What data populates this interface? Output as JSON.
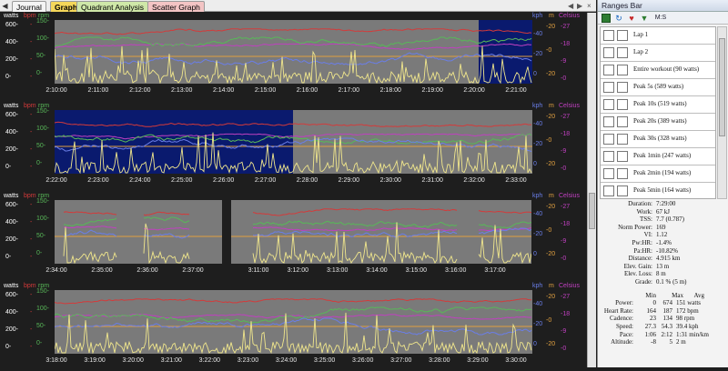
{
  "tabs": {
    "journal": "Journal",
    "graph": "Graph",
    "quadrant": "Quadrant Analysis",
    "scatter": "Scatter Graph"
  },
  "left_axis": {
    "watts_label": "watts",
    "bpm_label": "bpm",
    "rpm_label": "rpm",
    "watts_ticks": [
      "600-",
      "400-",
      "200-",
      "0-"
    ],
    "bpm_ticks": [
      "-",
      "-",
      "-",
      "-"
    ],
    "rpm_ticks": [
      "150-",
      "100-",
      "50-",
      "0-"
    ]
  },
  "right_axis": {
    "kph_label": "kph",
    "m_label": "m",
    "celsius_label": "Celsius",
    "c_ticks": [
      "-27",
      "-18",
      "-9",
      "-0"
    ],
    "m_ticks": [
      "-20",
      "-0",
      "-20"
    ],
    "kph_ticks": [
      "-40",
      "-20",
      "0"
    ]
  },
  "colors": {
    "watts": "#f0e68c",
    "bpm": "#d43a3a",
    "rpm": "#58b858",
    "kph": "#6a7ee8",
    "m": "#e0a040",
    "celsius": "#c040c0",
    "plot_bg": "#7a7a7a",
    "selection": "#0a1a6e"
  },
  "panels": [
    {
      "ticks": [
        "2:10:00",
        "2:11:00",
        "2:12:00",
        "2:13:00",
        "2:14:00",
        "2:15:00",
        "2:16:00",
        "2:17:00",
        "2:18:00",
        "2:19:00",
        "2:20:00",
        "2:21:00"
      ]
    },
    {
      "ticks": [
        "2:22:00",
        "2:23:00",
        "2:24:00",
        "2:25:00",
        "2:26:00",
        "2:27:00",
        "2:28:00",
        "2:29:00",
        "2:30:00",
        "2:31:00",
        "2:32:00",
        "2:33:00"
      ]
    },
    {
      "ticks_a": [
        "2:34:00",
        "2:35:00",
        "2:36:00",
        "2:37:00"
      ],
      "ticks_b": [
        "3:11:00",
        "3:12:00",
        "3:13:00",
        "3:14:00",
        "3:15:00",
        "3:16:00",
        "3:17:00"
      ]
    },
    {
      "ticks": [
        "3:18:00",
        "3:19:00",
        "3:20:00",
        "3:21:00",
        "3:22:00",
        "3:23:00",
        "3:24:00",
        "3:25:00",
        "3:26:00",
        "3:27:00",
        "3:28:00",
        "3:29:00",
        "3:30:00"
      ]
    }
  ],
  "ranges": {
    "title": "Ranges Bar",
    "toolbar_mode": "M:S",
    "items": [
      "Lap 1",
      "Lap 2",
      "Entire workout (90 watts)",
      "Peak 5s (589 watts)",
      "Peak 10s (519 watts)",
      "Peak 20s (389 watts)",
      "Peak 30s (328 watts)",
      "Peak 1min (247 watts)",
      "Peak 2min (194 watts)",
      "Peak 5min (164 watts)",
      "Peak 10min (151 watts)"
    ]
  },
  "stats": [
    {
      "k": "Duration:",
      "v": "7:29:00"
    },
    {
      "k": "Work:",
      "v": "67 kJ"
    },
    {
      "k": "TSS:",
      "v": "7.7 (0.787)"
    },
    {
      "k": "Norm Power:",
      "v": "169"
    },
    {
      "k": "VI:",
      "v": "1.12"
    },
    {
      "k": "Pw:HR:",
      "v": "-1.4%"
    },
    {
      "k": "Pa:HR:",
      "v": "-10.82%"
    },
    {
      "k": "Distance:",
      "v": "4.915 km"
    },
    {
      "k": "Elev. Gain:",
      "v": "13 m"
    },
    {
      "k": "Elev. Loss:",
      "v": "8 m"
    },
    {
      "k": "Grade:",
      "v": "0.1 % (5 m)"
    }
  ],
  "minmax": {
    "headers": [
      "Min",
      "Max",
      "Avg"
    ],
    "rows": [
      {
        "k": "Power:",
        "min": "0",
        "max": "674",
        "avg": "151 watts"
      },
      {
        "k": "Heart Rate:",
        "min": "164",
        "max": "187",
        "avg": "172 bpm"
      },
      {
        "k": "Cadence:",
        "min": "23",
        "max": "134",
        "avg": "98 rpm"
      },
      {
        "k": "Speed:",
        "min": "27.3",
        "max": "54.3",
        "avg": "39.4 kph"
      },
      {
        "k": "Pace:",
        "min": "1:06",
        "max": "2:12",
        "avg": "1:31 min/km"
      },
      {
        "k": "Altitude:",
        "min": "-8",
        "max": "5",
        "avg": "2 m"
      }
    ]
  }
}
